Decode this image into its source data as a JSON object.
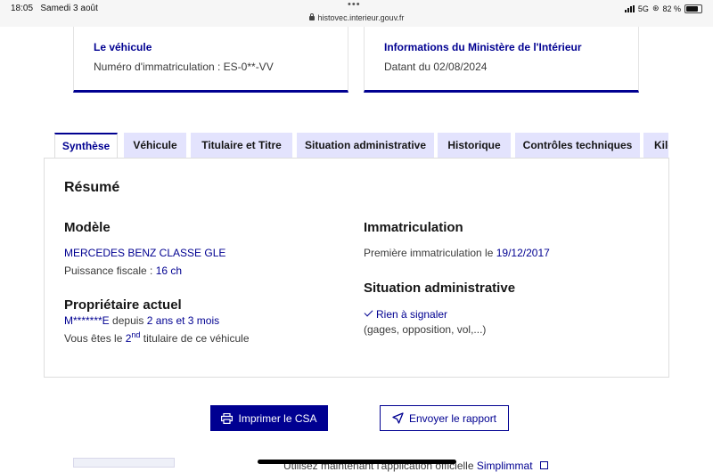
{
  "status_bar": {
    "time": "18:05",
    "date": "Samedi 3 août",
    "url": "histovec.interieur.gouv.fr",
    "network": "5G",
    "battery": "82 %"
  },
  "cards": {
    "vehicle": {
      "title": "Le véhicule",
      "text": "Numéro d'immatriculation : ES-0**-VV"
    },
    "ministry": {
      "title": "Informations du Ministère de l'Intérieur",
      "text": "Datant du 02/08/2024"
    }
  },
  "tabs": [
    "Synthèse",
    "Véhicule",
    "Titulaire et Titre",
    "Situation administrative",
    "Historique",
    "Contrôles techniques",
    "Kilo"
  ],
  "active_tab": "Synthèse",
  "summary": {
    "title": "Résumé",
    "model": {
      "heading": "Modèle",
      "name": "MERCEDES BENZ CLASSE GLE",
      "power_label": "Puissance fiscale :",
      "power_value": "16 ch"
    },
    "owner": {
      "heading": "Propriétaire actuel",
      "name": "M*******E",
      "since_label": "depuis",
      "since_value": "2 ans et 3 mois",
      "rank_prefix": "Vous êtes le",
      "rank_number": "2",
      "rank_suffix": "nd",
      "rank_tail": "titulaire de ce véhicule"
    },
    "registration": {
      "heading": "Immatriculation",
      "first_label": "Première immatriculation le",
      "first_date": "19/12/2017"
    },
    "admin": {
      "heading": "Situation administrative",
      "status": "Rien à signaler",
      "details": "(gages, opposition, vol,...)"
    }
  },
  "actions": {
    "print_label": "Imprimer le CSA",
    "send_label": "Envoyer le rapport"
  },
  "footer": {
    "text_prefix": "Utilisez maintenant l'application officielle",
    "link": "Simplimmat"
  },
  "colors": {
    "primary": "#000091",
    "tab_bg": "#e3e3fd"
  },
  "icons": [
    "lock-icon",
    "signal-icon",
    "battery-icon",
    "check-icon",
    "printer-icon",
    "send-icon",
    "external-link-icon"
  ]
}
